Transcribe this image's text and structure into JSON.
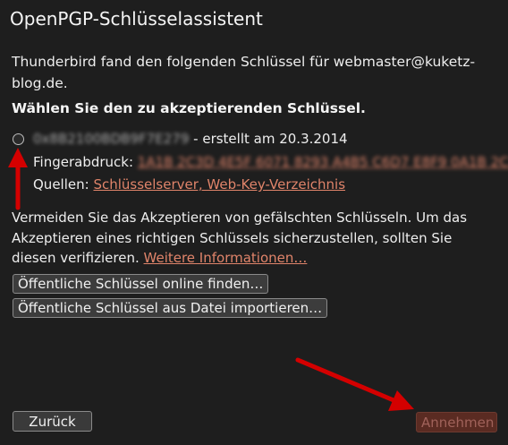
{
  "dialog": {
    "title": "OpenPGP-Schlüsselassistent",
    "intro": "Thunderbird fand den folgenden Schlüssel für webmaster@kuketz-blog.de.",
    "heading": "Wählen Sie den zu akzeptierenden Schlüssel."
  },
  "key": {
    "id_redacted": "0x8B2100BDB9F7E279",
    "created": " - erstellt am 20.3.2014",
    "fingerprint_label": "Fingerabdruck: ",
    "fingerprint_redacted": "1A1B 2C3D 4E5F 6071 8293 A4B5 C6D7 E8F9 0A1B 2C3D",
    "sources_label": "Quellen: ",
    "sources_link": "Schlüsselserver, Web-Key-Verzeichnis"
  },
  "warning": {
    "text": "Vermeiden Sie das Akzeptieren von gefälschten Schlüsseln. Um das Akzeptieren eines richtigen Schlüssels sicherzustellen, sollten Sie diesen verifizieren. ",
    "link": "Weitere Informationen…"
  },
  "buttons": {
    "find_online": "Öffentliche Schlüssel online finden…",
    "import_file": "Öffentliche Schlüssel aus Datei importieren…",
    "back": "Zurück",
    "accept": "Annehmen"
  },
  "colors": {
    "background": "#1e1e1e",
    "link": "#e0846a",
    "annotation_arrow": "#d40000",
    "accept_disabled": "#5a2b22"
  },
  "icons": {
    "arrows": [
      "arrow-up-icon",
      "arrow-diagonal-icon"
    ]
  }
}
